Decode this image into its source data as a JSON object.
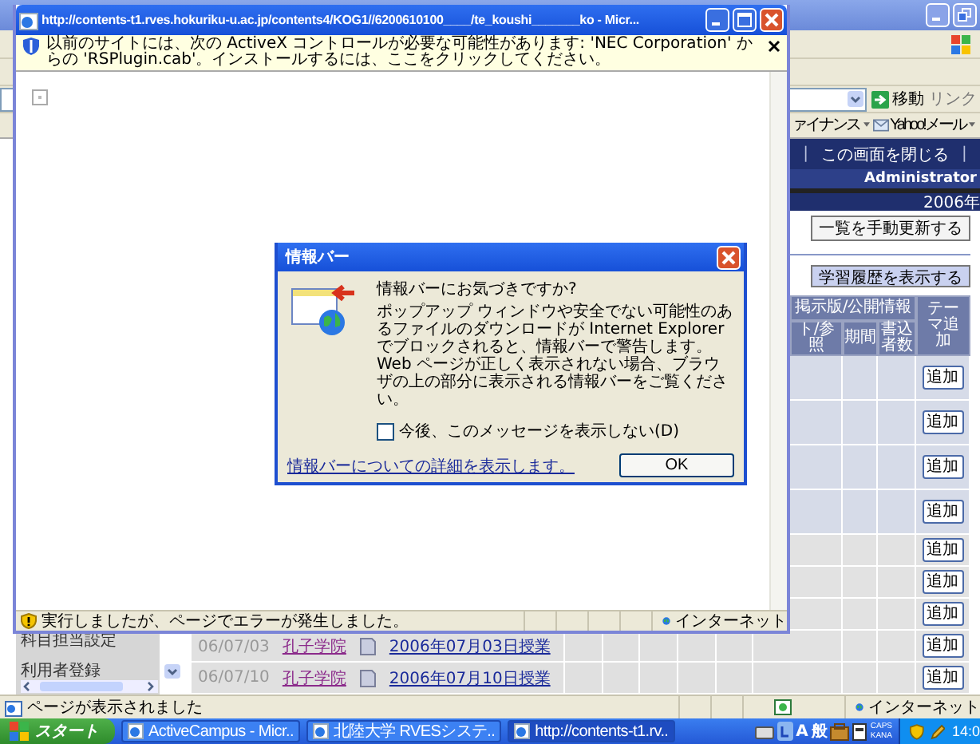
{
  "browser": {
    "address_bar": {
      "go_button": "移動",
      "links_label": "リンク"
    },
    "links_bar": [
      {
        "label": "ァイナンス",
        "kind": "link"
      },
      {
        "label": "Yahoo!メール",
        "kind": "mail"
      }
    ],
    "page": {
      "nav": [
        {
          "kind": "separator",
          "text": "|"
        },
        {
          "kind": "link",
          "text": "この画面を閉じる"
        },
        {
          "kind": "separator",
          "text": "|"
        }
      ],
      "user": "Administrator",
      "year": "2006年",
      "refresh_button": "一覧を手動更新する",
      "history_button": "学習履歴を表示する",
      "table": {
        "group_header": "掲示版/公開情報",
        "add_header": "テーマ追加",
        "columns": [
          "ト/参照",
          "期間",
          "書込者数"
        ],
        "rows": [
          {
            "kind": "theme",
            "button": "追加"
          },
          {
            "kind": "theme",
            "button": "追加"
          },
          {
            "kind": "theme",
            "button": "追加"
          },
          {
            "kind": "theme",
            "button": "追加"
          },
          {
            "kind": "lesson",
            "button": "追加"
          },
          {
            "kind": "lesson",
            "button": "追加"
          },
          {
            "kind": "lesson",
            "button": "追加"
          },
          {
            "kind": "lesson",
            "button": "追加"
          },
          {
            "kind": "lesson",
            "button": "追加"
          }
        ]
      },
      "sidebar": [
        "科目担当設定",
        "利用者登録"
      ],
      "lessons": [
        {
          "date": "06/07/03",
          "course": "孔子学院",
          "title": "2006年07月03日授業"
        },
        {
          "date": "06/07/10",
          "course": "孔子学院",
          "title": "2006年07月10日授業"
        }
      ]
    },
    "status": {
      "text": "ページが表示されました",
      "zone": "インターネット"
    }
  },
  "popup": {
    "title": "http://contents-t1.rves.hokuriku-u.ac.jp/contents4/KOG1//6200610100____/te_koushi_______ko - Micr...",
    "info_bar": "以前のサイトには、次の ActiveX コントロールが必要な可能性があります: 'NEC Corporation' からの 'RSPlugin.cab'。インストールするには、ここをクリックしてください。",
    "status": {
      "text": "実行しましたが、ページでエラーが発生しました。",
      "zone": "インターネット"
    }
  },
  "dialog": {
    "title": "情報バー",
    "heading": "情報バーにお気づきですか?",
    "body": "ポップアップ ウィンドウや安全でない可能性のあるファイルのダウンロードが Internet Explorer でブロックされると、情報バーで警告します。Web ページが正しく表示されない場合、ブラウザの上の部分に表示される情報バーをご覧ください。",
    "checkbox": {
      "label": "今後、このメッセージを表示しない(D)",
      "checked": false
    },
    "link": "情報バーについての詳細を表示します。",
    "ok_button": "OK"
  },
  "taskbar": {
    "start": "スタート",
    "tasks": [
      {
        "label": "ActiveCampus - Micr..",
        "selected": false
      },
      {
        "label": "北陸大学 RVESシステ..",
        "selected": false
      },
      {
        "label": "http://contents-t1.rv..",
        "selected": true
      }
    ],
    "tray": {
      "ime_mode": "A",
      "ime_kanji": "般",
      "caps": "CAPS",
      "kana": "KANA",
      "clock": "14:0"
    }
  }
}
